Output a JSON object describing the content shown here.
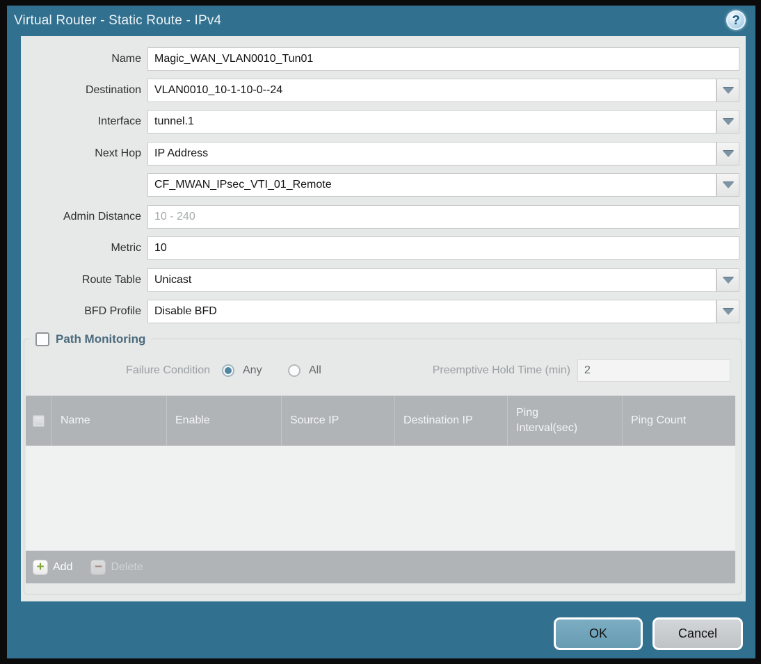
{
  "dialog": {
    "title": "Virtual Router - Static Route - IPv4",
    "help_glyph": "?"
  },
  "fields": {
    "name": {
      "label": "Name",
      "value": "Magic_WAN_VLAN0010_Tun01"
    },
    "destination": {
      "label": "Destination",
      "value": "VLAN0010_10-1-10-0--24"
    },
    "interface": {
      "label": "Interface",
      "value": "tunnel.1"
    },
    "next_hop": {
      "label": "Next Hop",
      "value": "IP Address"
    },
    "next_hop_address": {
      "value": "CF_MWAN_IPsec_VTI_01_Remote"
    },
    "admin_distance": {
      "label": "Admin Distance",
      "placeholder": "10 - 240"
    },
    "metric": {
      "label": "Metric",
      "value": "10"
    },
    "route_table": {
      "label": "Route Table",
      "value": "Unicast"
    },
    "bfd_profile": {
      "label": "BFD Profile",
      "value": "Disable BFD"
    }
  },
  "path_monitoring": {
    "title": "Path Monitoring",
    "checked": false,
    "failure_condition": {
      "label": "Failure Condition",
      "options": [
        {
          "label": "Any",
          "selected": true
        },
        {
          "label": "All",
          "selected": false
        }
      ]
    },
    "preemptive_hold_time": {
      "label": "Preemptive Hold Time (min)",
      "value": "2"
    },
    "table": {
      "columns": [
        "Name",
        "Enable",
        "Source IP",
        "Destination IP",
        "Ping Interval(sec)",
        "Ping Count"
      ],
      "rows": []
    },
    "actions": {
      "add_label": "Add",
      "add_glyph": "+",
      "delete_label": "Delete",
      "delete_glyph": "−",
      "delete_enabled": false
    }
  },
  "footer": {
    "ok_label": "OK",
    "cancel_label": "Cancel"
  },
  "colors": {
    "frame_teal": "#31708f",
    "content_bg": "#e7e8e8",
    "table_header_gray": "#b0b4b6",
    "table_body": "#f0f1f1",
    "ok_button": "#6fa3b8",
    "cancel_button": "#c9cdd0",
    "add_green": "#7fa638",
    "delete_red": "#9c5f52",
    "section_title": "#4a6b7c",
    "dropdown_arrow": "#7e94a4"
  }
}
